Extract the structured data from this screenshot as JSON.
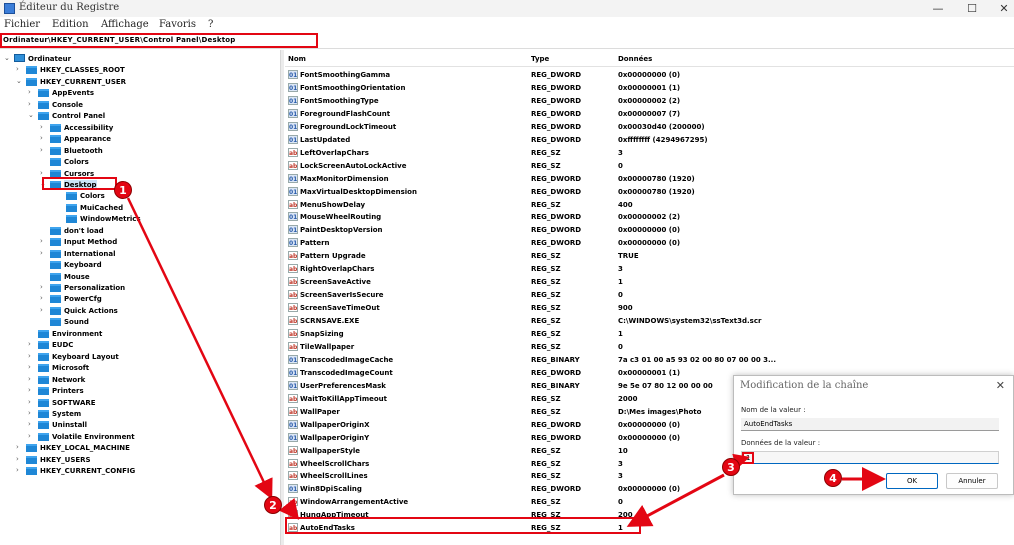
{
  "window": {
    "title": "Éditeur du Registre",
    "controls": {
      "minimize": "—",
      "maximize": "☐",
      "close": "✕"
    }
  },
  "menu": [
    "Fichier",
    "Edition",
    "Affichage",
    "Favoris",
    "?"
  ],
  "address": "Ordinateur\\HKEY_CURRENT_USER\\Control Panel\\Desktop",
  "tree": [
    {
      "label": "Ordinateur",
      "level": 0,
      "expanded": true,
      "icon": "computer-icon"
    },
    {
      "label": "HKEY_CLASSES_ROOT",
      "level": 1,
      "expanded": false
    },
    {
      "label": "HKEY_CURRENT_USER",
      "level": 1,
      "expanded": true
    },
    {
      "label": "AppEvents",
      "level": 2,
      "expanded": false
    },
    {
      "label": "Console",
      "level": 2,
      "expanded": false
    },
    {
      "label": "Control Panel",
      "level": 2,
      "expanded": true
    },
    {
      "label": "Accessibility",
      "level": 3,
      "expanded": false
    },
    {
      "label": "Appearance",
      "level": 3,
      "expanded": false
    },
    {
      "label": "Bluetooth",
      "level": 3,
      "expanded": false
    },
    {
      "label": "Colors",
      "level": 3,
      "expanded": null
    },
    {
      "label": "Cursors",
      "level": 3,
      "expanded": false
    },
    {
      "label": "Desktop",
      "level": 3,
      "expanded": true,
      "selected": true
    },
    {
      "label": "Colors",
      "level": 4,
      "expanded": null
    },
    {
      "label": "MuiCached",
      "level": 4,
      "expanded": null
    },
    {
      "label": "WindowMetrics",
      "level": 4,
      "expanded": null
    },
    {
      "label": "don't load",
      "level": 3,
      "expanded": null
    },
    {
      "label": "Input Method",
      "level": 3,
      "expanded": false
    },
    {
      "label": "International",
      "level": 3,
      "expanded": false
    },
    {
      "label": "Keyboard",
      "level": 3,
      "expanded": null
    },
    {
      "label": "Mouse",
      "level": 3,
      "expanded": null
    },
    {
      "label": "Personalization",
      "level": 3,
      "expanded": false
    },
    {
      "label": "PowerCfg",
      "level": 3,
      "expanded": false
    },
    {
      "label": "Quick Actions",
      "level": 3,
      "expanded": false
    },
    {
      "label": "Sound",
      "level": 3,
      "expanded": null
    },
    {
      "label": "Environment",
      "level": 2,
      "expanded": null
    },
    {
      "label": "EUDC",
      "level": 2,
      "expanded": false
    },
    {
      "label": "Keyboard Layout",
      "level": 2,
      "expanded": false
    },
    {
      "label": "Microsoft",
      "level": 2,
      "expanded": false
    },
    {
      "label": "Network",
      "level": 2,
      "expanded": false
    },
    {
      "label": "Printers",
      "level": 2,
      "expanded": false
    },
    {
      "label": "SOFTWARE",
      "level": 2,
      "expanded": false
    },
    {
      "label": "System",
      "level": 2,
      "expanded": false
    },
    {
      "label": "Uninstall",
      "level": 2,
      "expanded": false
    },
    {
      "label": "Volatile Environment",
      "level": 2,
      "expanded": false
    },
    {
      "label": "HKEY_LOCAL_MACHINE",
      "level": 1,
      "expanded": false
    },
    {
      "label": "HKEY_USERS",
      "level": 1,
      "expanded": false
    },
    {
      "label": "HKEY_CURRENT_CONFIG",
      "level": 1,
      "expanded": false
    }
  ],
  "columns": {
    "name": "Nom",
    "type": "Type",
    "data": "Données"
  },
  "values": [
    {
      "name": "FontSmoothingGamma",
      "type": "REG_DWORD",
      "data": "0x00000000 (0)",
      "kind": "bin"
    },
    {
      "name": "FontSmoothingOrientation",
      "type": "REG_DWORD",
      "data": "0x00000001 (1)",
      "kind": "bin"
    },
    {
      "name": "FontSmoothingType",
      "type": "REG_DWORD",
      "data": "0x00000002 (2)",
      "kind": "bin"
    },
    {
      "name": "ForegroundFlashCount",
      "type": "REG_DWORD",
      "data": "0x00000007 (7)",
      "kind": "bin"
    },
    {
      "name": "ForegroundLockTimeout",
      "type": "REG_DWORD",
      "data": "0x00030d40 (200000)",
      "kind": "bin"
    },
    {
      "name": "LastUpdated",
      "type": "REG_DWORD",
      "data": "0xffffffff (4294967295)",
      "kind": "bin"
    },
    {
      "name": "LeftOverlapChars",
      "type": "REG_SZ",
      "data": "3",
      "kind": "sz"
    },
    {
      "name": "LockScreenAutoLockActive",
      "type": "REG_SZ",
      "data": "0",
      "kind": "sz"
    },
    {
      "name": "MaxMonitorDimension",
      "type": "REG_DWORD",
      "data": "0x00000780 (1920)",
      "kind": "bin"
    },
    {
      "name": "MaxVirtualDesktopDimension",
      "type": "REG_DWORD",
      "data": "0x00000780 (1920)",
      "kind": "bin"
    },
    {
      "name": "MenuShowDelay",
      "type": "REG_SZ",
      "data": "400",
      "kind": "sz"
    },
    {
      "name": "MouseWheelRouting",
      "type": "REG_DWORD",
      "data": "0x00000002 (2)",
      "kind": "bin"
    },
    {
      "name": "PaintDesktopVersion",
      "type": "REG_DWORD",
      "data": "0x00000000 (0)",
      "kind": "bin"
    },
    {
      "name": "Pattern",
      "type": "REG_DWORD",
      "data": "0x00000000 (0)",
      "kind": "bin"
    },
    {
      "name": "Pattern Upgrade",
      "type": "REG_SZ",
      "data": "TRUE",
      "kind": "sz"
    },
    {
      "name": "RightOverlapChars",
      "type": "REG_SZ",
      "data": "3",
      "kind": "sz"
    },
    {
      "name": "ScreenSaveActive",
      "type": "REG_SZ",
      "data": "1",
      "kind": "sz"
    },
    {
      "name": "ScreenSaverIsSecure",
      "type": "REG_SZ",
      "data": "0",
      "kind": "sz"
    },
    {
      "name": "ScreenSaveTimeOut",
      "type": "REG_SZ",
      "data": "900",
      "kind": "sz"
    },
    {
      "name": "SCRNSAVE.EXE",
      "type": "REG_SZ",
      "data": "C:\\WINDOWS\\system32\\ssText3d.scr",
      "kind": "sz"
    },
    {
      "name": "SnapSizing",
      "type": "REG_SZ",
      "data": "1",
      "kind": "sz"
    },
    {
      "name": "TileWallpaper",
      "type": "REG_SZ",
      "data": "0",
      "kind": "sz"
    },
    {
      "name": "TranscodedImageCache",
      "type": "REG_BINARY",
      "data": "7a c3 01 00 a5 93 02 00 80 07 00 00 3...",
      "kind": "bin"
    },
    {
      "name": "TranscodedImageCount",
      "type": "REG_DWORD",
      "data": "0x00000001 (1)",
      "kind": "bin"
    },
    {
      "name": "UserPreferencesMask",
      "type": "REG_BINARY",
      "data": "9e 5e 07 80 12 00 00 00",
      "kind": "bin"
    },
    {
      "name": "WaitToKillAppTimeout",
      "type": "REG_SZ",
      "data": "2000",
      "kind": "sz"
    },
    {
      "name": "WallPaper",
      "type": "REG_SZ",
      "data": "D:\\Mes images\\Photo",
      "kind": "sz"
    },
    {
      "name": "WallpaperOriginX",
      "type": "REG_DWORD",
      "data": "0x00000000 (0)",
      "kind": "bin"
    },
    {
      "name": "WallpaperOriginY",
      "type": "REG_DWORD",
      "data": "0x00000000 (0)",
      "kind": "bin"
    },
    {
      "name": "WallpaperStyle",
      "type": "REG_SZ",
      "data": "10",
      "kind": "sz"
    },
    {
      "name": "WheelScrollChars",
      "type": "REG_SZ",
      "data": "3",
      "kind": "sz"
    },
    {
      "name": "WheelScrollLines",
      "type": "REG_SZ",
      "data": "3",
      "kind": "sz"
    },
    {
      "name": "Win8DpiScaling",
      "type": "REG_DWORD",
      "data": "0x00000000 (0)",
      "kind": "bin"
    },
    {
      "name": "WindowArrangementActive",
      "type": "REG_SZ",
      "data": "0",
      "kind": "sz"
    },
    {
      "name": "HungAppTimeout",
      "type": "REG_SZ",
      "data": "200",
      "kind": "sz"
    },
    {
      "name": "AutoEndTasks",
      "type": "REG_SZ",
      "data": "1",
      "kind": "sz",
      "selected": true
    }
  ],
  "dialog": {
    "title": "Modification de la chaîne",
    "close": "✕",
    "name_label": "Nom de la valeur :",
    "name_value": "AutoEndTasks",
    "data_label": "Données de la valeur :",
    "data_value": "1",
    "ok": "OK",
    "cancel": "Annuler"
  },
  "callouts": [
    "1",
    "2",
    "3",
    "4"
  ],
  "colors": {
    "highlight": "#e30613",
    "folder": "#1f87d6",
    "selection": "#cce4f7"
  }
}
